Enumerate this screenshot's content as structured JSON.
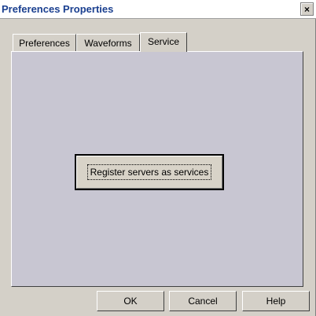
{
  "window": {
    "title": "Preferences Properties",
    "close_glyph": "×"
  },
  "tabs": [
    {
      "label": "Preferences",
      "active": false
    },
    {
      "label": "Waveforms",
      "active": false
    },
    {
      "label": "Service",
      "active": true
    }
  ],
  "service_tab": {
    "register_button_label": "Register servers as services"
  },
  "footer": {
    "ok_label": "OK",
    "cancel_label": "Cancel",
    "help_label": "Help"
  },
  "colors": {
    "title_text": "#1a3f8f",
    "panel_bg": "#c8c6d2",
    "dialog_bg": "#d4d0c8"
  }
}
